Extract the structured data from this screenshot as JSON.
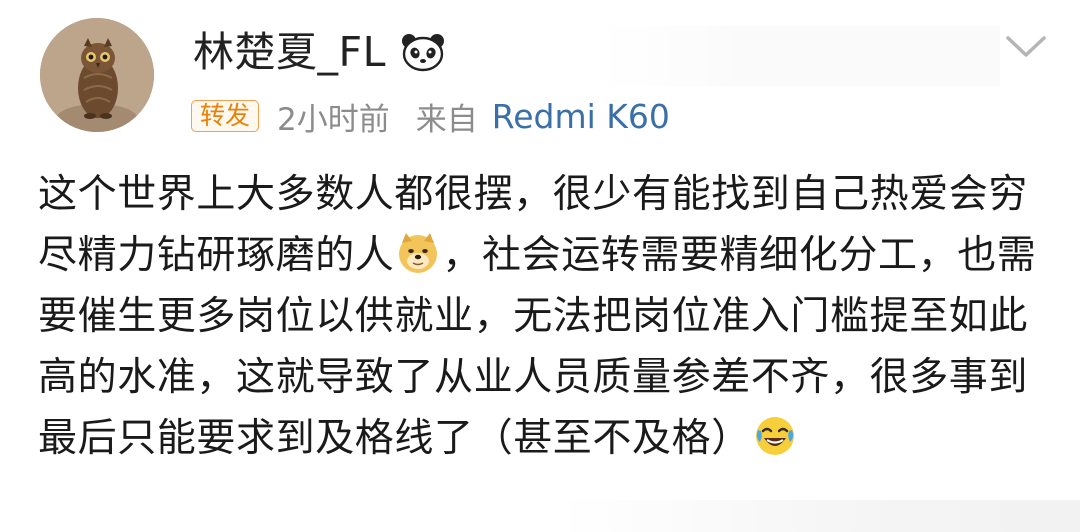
{
  "post": {
    "author": {
      "name": "林楚夏_FL",
      "badge_icon": "panda-icon",
      "avatar_icon": "owl-avatar"
    },
    "meta": {
      "repost_tag": "转发",
      "time": "2小时前",
      "source_prefix": "来自",
      "source_device": "Redmi K60"
    },
    "content": {
      "part1": "这个世界上大多数人都很摆，很少有能找到自己热爱会穷尽精力钻研琢磨的人",
      "emoji1": "doge-icon",
      "part2": "，社会运转需要精细化分工，也需要催生更多岗位以供就业，无法把岗位准入门槛提至如此高的水准，这就导致了从业人员质量参差不齐，很多事到最后只能要求到及格线了（甚至不及格）",
      "emoji2": "laugh-cry-icon"
    },
    "dropdown_icon": "chevron-down-icon",
    "colors": {
      "tag_orange": "#e8820a",
      "link_blue": "#3a6fa8",
      "meta_gray": "#8c8c8c"
    }
  }
}
